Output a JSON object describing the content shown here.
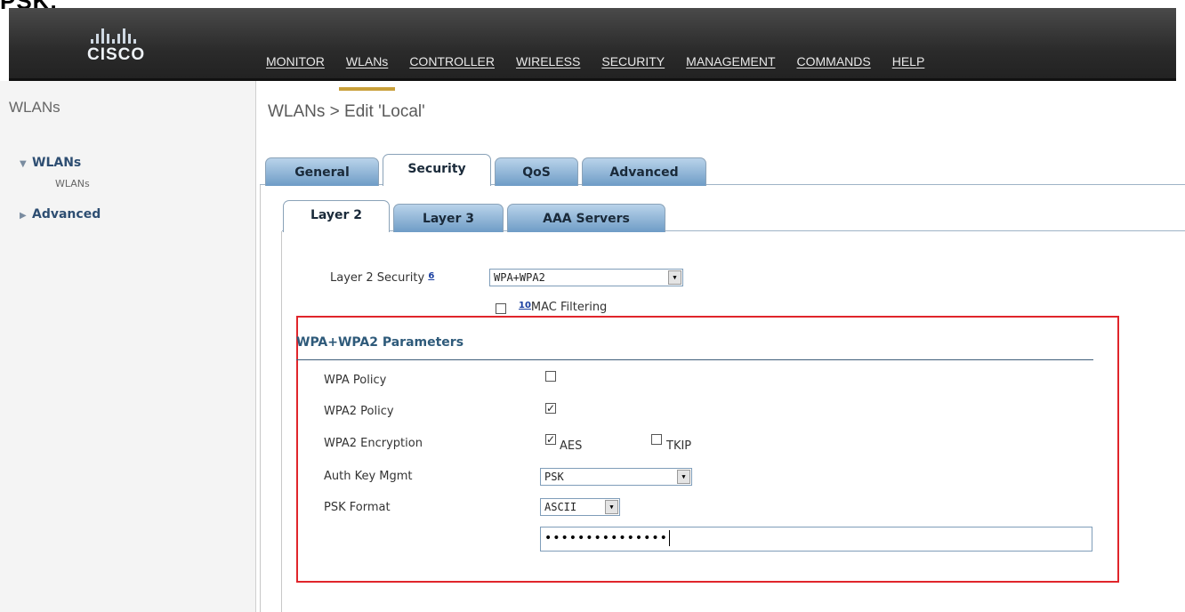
{
  "clip_text": "PSK.",
  "brand": "CISCO",
  "topnav": [
    "MONITOR",
    "WLANs",
    "CONTROLLER",
    "WIRELESS",
    "SECURITY",
    "MANAGEMENT",
    "COMMANDS",
    "HELP"
  ],
  "sidebar": {
    "title": "WLANs",
    "items": [
      {
        "label": "WLANs",
        "arrow": "▼",
        "sub": "WLANs"
      },
      {
        "label": "Advanced",
        "arrow": "▶"
      }
    ]
  },
  "breadcrumb": "WLANs > Edit  'Local'",
  "tabs": [
    "General",
    "Security",
    "QoS",
    "Advanced"
  ],
  "subtabs": [
    "Layer 2",
    "Layer 3",
    "AAA Servers"
  ],
  "layer2": {
    "security_label": "Layer 2 Security",
    "help_marker": "6",
    "security_value": "WPA+WPA2",
    "mac_marker": "10",
    "mac_filtering_label": "MAC Filtering"
  },
  "params": {
    "title": "WPA+WPA2 Parameters",
    "wpa_policy_label": "WPA Policy",
    "wpa2_policy_label": "WPA2 Policy",
    "wpa2_encryption_label": "WPA2 Encryption",
    "aes_label": "AES",
    "tkip_label": "TKIP",
    "auth_key_label": "Auth Key Mgmt",
    "auth_key_value": "PSK",
    "psk_format_label": "PSK Format",
    "psk_format_value": "ASCII",
    "psk_value": "•••••••••••••••"
  },
  "colors": {
    "highlight_box": "#e0252b",
    "tab_gradient": "#6e9cc6",
    "header_bg": "#2b2b2b"
  }
}
